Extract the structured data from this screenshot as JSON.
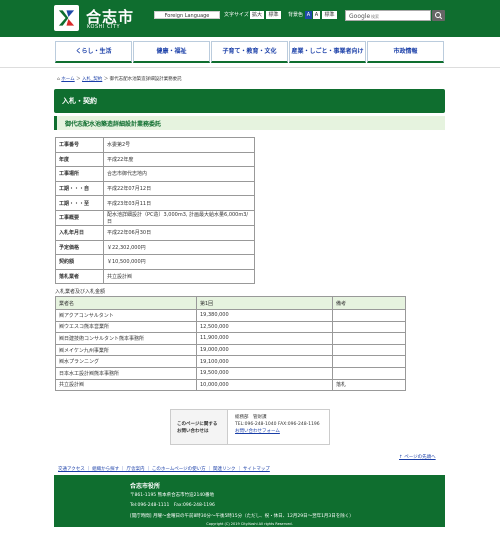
{
  "header": {
    "city_name": "合志市",
    "city_sub": "KOSHI CITY",
    "lang_button": "Foreign Language",
    "font_size_label": "文字サイズ",
    "font_size_big": "拡大",
    "font_size_std": "標準",
    "bg_label": "背景色",
    "bg_a1": "A",
    "bg_a2": "A",
    "bg_std": "標準",
    "search_brand": "Google",
    "search_placeholder": "検索",
    "brand_color": "#0f6e2f"
  },
  "nav": {
    "items": [
      "くらし・生活",
      "健康・福祉",
      "子育て・教育・文化",
      "産業・しごと・事業者向け",
      "市政情報"
    ]
  },
  "breadcrumb": {
    "home": "ホーム",
    "sep1": "＞",
    "level2": "入札_契約",
    "sep2": "＞",
    "current": "御代志配水池築造詳細設計業務委託"
  },
  "page": {
    "category_title": "入札・契約",
    "page_title": "御代志配水池築造詳細設計業務委託"
  },
  "info_table": {
    "rows": [
      {
        "key": "工事番号",
        "value": "水委第2号"
      },
      {
        "key": "年度",
        "value": "平成22年度"
      },
      {
        "key": "工事場所",
        "value": "合志市御代志地内"
      },
      {
        "key": "工期・・・自",
        "value": "平成22年07月12日"
      },
      {
        "key": "工期・・・至",
        "value": "平成23年03月11日"
      },
      {
        "key": "工事概要",
        "value": "配水池詳細設計（PC造）3,000m3, 計画最大給水量6,000m3/日"
      },
      {
        "key": "入札年月日",
        "value": "平成22年06月30日"
      },
      {
        "key": "予定価格",
        "value": "￥22,302,000円"
      },
      {
        "key": "契約額",
        "value": "￥10,500,000円"
      },
      {
        "key": "落札業者",
        "value": "共立設計㈱"
      }
    ]
  },
  "bid_table": {
    "caption": "入札業者及び入札金額",
    "headers": [
      "業者名",
      "第1回",
      "備考"
    ],
    "rows": [
      {
        "name": "㈱アクアコンサルタント",
        "amount": "19,380,000",
        "note": ""
      },
      {
        "name": "㈱ウエスコ熊本営業所",
        "amount": "12,500,000",
        "note": ""
      },
      {
        "name": "㈱日建技術コンサルタント熊本事務所",
        "amount": "11,900,000",
        "note": ""
      },
      {
        "name": "㈱メイケン九州事業所",
        "amount": "19,000,000",
        "note": ""
      },
      {
        "name": "㈱水プランニング",
        "amount": "19,100,000",
        "note": ""
      },
      {
        "name": "日本水工設計㈱熊本事務所",
        "amount": "19,500,000",
        "note": ""
      },
      {
        "name": "共立設計㈱",
        "amount": "10,000,000",
        "note": "落札"
      }
    ]
  },
  "contact": {
    "label_line1": "このページに関する",
    "label_line2": "お問い合わせは",
    "dept": "総務部　管財課",
    "tel": "TEL:096-248-1040 FAX:096-248-1196",
    "link": "お問い合わせフォーム"
  },
  "to_top": "↑ ページの先頭へ",
  "footer_links": "交通アクセス ｜ 組織から探す ｜ 庁舎案内 ｜ このホームページの使い方 ｜ 関連リンク ｜ サイトマップ",
  "footer": {
    "name": "合志市役所",
    "address": "〒861-1195  熊本県合志市竹迫2140番地",
    "tel": "Tel:096-248-1111　Fax:096-248-1196",
    "hours": "[開庁時間] 月曜〜金曜日の午前8時30分〜午後5時15分（ただし、祝・休日、12月29日〜翌年1月3日を除く）",
    "copyright": "Copyright (C) 2019 City.Koshi All rights Reserved."
  }
}
